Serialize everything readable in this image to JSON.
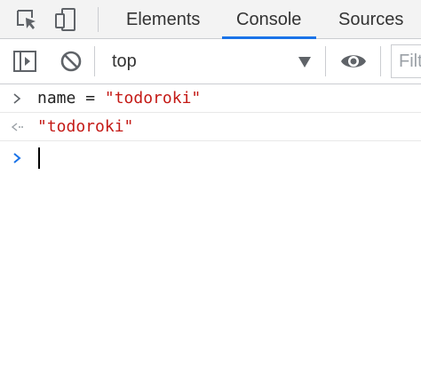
{
  "tabs": {
    "elements": "Elements",
    "console": "Console",
    "sources": "Sources",
    "active": "Console"
  },
  "toolbar": {
    "context": "top",
    "filter_placeholder": "Filter"
  },
  "console": {
    "entries": [
      {
        "type": "input",
        "icon": "chevron-right-icon",
        "var": "name",
        "operator": " = ",
        "string": "\"todoroki\""
      },
      {
        "type": "result",
        "icon": "result-arrow-icon",
        "string": "\"todoroki\""
      }
    ],
    "prompt_icon": "prompt-chevron-icon"
  },
  "colors": {
    "accent": "#1a73e8",
    "string": "#c41a16",
    "icon": "#5f6368",
    "tabbar_bg": "#f3f3f3"
  }
}
